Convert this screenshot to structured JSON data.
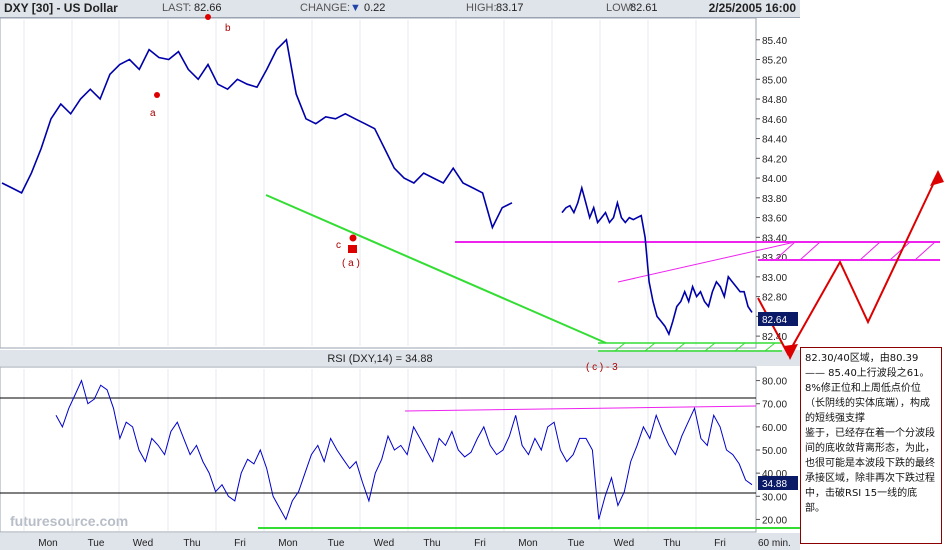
{
  "header": {
    "symbol": "DXY [30] - US Dollar",
    "last_label": "LAST:",
    "last_value": "82.66",
    "change_label": "CHANGE:",
    "change_value": "0.22",
    "high_label": "HIGH:",
    "high_value": "83.17",
    "low_label": "LOW:",
    "low_value": "82.61",
    "datetime": "2/25/2005 16:00"
  },
  "rsi_label": "RSI (DXY,14) = 34.88",
  "watermark": "futuresource.com",
  "annotations": {
    "wave_a": "a",
    "wave_b": "b",
    "wave_c": "c",
    "wave_paren_a": "( a )",
    "wave_c3": "( c ) - 3"
  },
  "note_lines": [
    "82.30/40区域，由80.39 —— 85.40上行波段之61。8%修正位和上周低点价位（长阴线的实体底端），构成的短线强支撑",
    "鉴于，已经存在着一个分波段间的底收敛背离形态，为此，也很可能是本波段下跌的最终承接区域，除非再次下跌过程中，击破RSI 15一线的底部。"
  ],
  "colors": {
    "price": "#0000aa",
    "trendline": "#33dd33",
    "magenta": "#ee22ee",
    "projection": "#dd0000",
    "header_bg": "#dfe3ea"
  },
  "chart_data": {
    "type": "line",
    "title": "DXY [30] - US Dollar",
    "x_label_unit": "60 min.",
    "x_ticks": [
      "Mon",
      "Tue",
      "Wed",
      "Thu",
      "Fri",
      "Mon",
      "Tue",
      "Wed",
      "Thu",
      "Fri",
      "Mon",
      "Tue",
      "Wed",
      "Thu",
      "Fri"
    ],
    "price_axis": {
      "ylim": [
        82.3,
        85.6
      ],
      "ticks": [
        "85.40",
        "85.20",
        "85.00",
        "84.80",
        "84.60",
        "84.40",
        "84.20",
        "84.00",
        "83.80",
        "83.60",
        "83.40",
        "83.20",
        "83.00",
        "82.80",
        "82.60",
        "82.40"
      ],
      "last_value_label": "82.64"
    },
    "rsi_axis": {
      "ylim": [
        15,
        85
      ],
      "ticks": [
        "80.00",
        "70.00",
        "60.00",
        "50.00",
        "40.00",
        "30.00",
        "20.00"
      ],
      "last_value_label": "34.88",
      "reference_lines": [
        70,
        30
      ]
    },
    "price_series": {
      "name": "DXY",
      "x": [
        0,
        3,
        5,
        8,
        10,
        12,
        14,
        15,
        17,
        19,
        21,
        23,
        25,
        27,
        30,
        32,
        34,
        36,
        38,
        40,
        42,
        44,
        46,
        48,
        50,
        53,
        55,
        57,
        59,
        61,
        63,
        64,
        66,
        68,
        70,
        72,
        74,
        76,
        77,
        78,
        80,
        82,
        84,
        86,
        88,
        90,
        92,
        94,
        96,
        98,
        100,
        102,
        104,
        106,
        108,
        110,
        111,
        113,
        115,
        117,
        119,
        121,
        123,
        125,
        127,
        129,
        131,
        133,
        135,
        137,
        139,
        141,
        143,
        145,
        147,
        149,
        151,
        153,
        155,
        157,
        159,
        161,
        163,
        165,
        167,
        169,
        171,
        173,
        175,
        177,
        179,
        181,
        183,
        185,
        187,
        189,
        191,
        193,
        195,
        197,
        199,
        201,
        203,
        205,
        207,
        209,
        211,
        213,
        215,
        217,
        219,
        221,
        223,
        225,
        227,
        229,
        231,
        233,
        235,
        237,
        239,
        241,
        243,
        245,
        247,
        249,
        251,
        253,
        255,
        257,
        259,
        261,
        263,
        265,
        267,
        269,
        271,
        273,
        275,
        277,
        279,
        281,
        283
      ],
      "values": [
        83.95,
        83.9,
        83.85,
        84.05,
        84.3,
        84.6,
        84.75,
        84.65,
        84.8,
        84.9,
        84.8,
        85.05,
        85.15,
        85.2,
        85.1,
        85.3,
        85.22,
        85.2,
        85.28,
        85.1,
        85.0,
        85.15,
        84.95,
        84.9,
        85.0,
        84.95,
        84.92,
        85.1,
        85.3,
        85.4,
        84.85,
        84.6,
        84.55,
        84.62,
        84.6,
        84.65,
        84.6,
        84.55,
        84.5,
        84.3,
        84.1,
        84.0,
        83.95,
        84.05,
        84.0,
        83.95,
        84.1,
        83.95,
        83.9,
        83.85,
        83.5,
        83.7,
        83.75,
        83.65,
        83.7,
        83.72,
        83.65,
        83.75,
        83.9,
        83.75,
        83.6,
        83.7,
        83.55,
        83.6,
        83.65,
        83.55,
        83.6,
        83.75,
        83.6,
        83.55,
        83.6,
        83.58,
        83.6,
        83.62,
        83.4,
        82.95,
        82.75,
        82.6,
        82.55,
        82.5,
        82.42,
        82.55,
        82.7,
        82.75,
        82.85,
        82.75,
        82.9,
        82.8,
        82.85,
        82.75,
        82.7,
        82.85,
        82.95,
        82.9,
        82.8,
        83.0,
        82.95,
        82.9,
        82.85,
        82.85,
        82.7,
        82.64
      ]
    },
    "rsi_series": {
      "name": "RSI",
      "values": [
        65,
        60,
        68,
        74,
        80,
        70,
        72,
        78,
        76,
        68,
        55,
        62,
        60,
        50,
        45,
        55,
        52,
        48,
        58,
        62,
        55,
        48,
        52,
        45,
        40,
        32,
        35,
        30,
        28,
        40,
        46,
        44,
        50,
        42,
        30,
        25,
        20,
        28,
        32,
        40,
        48,
        52,
        45,
        55,
        50,
        46,
        42,
        45,
        36,
        28,
        40,
        46,
        56,
        50,
        52,
        48,
        60,
        55,
        50,
        45,
        55,
        52,
        58,
        50,
        47,
        49,
        55,
        60,
        52,
        48,
        50,
        56,
        65,
        52,
        48,
        55,
        50,
        60,
        62,
        50,
        45,
        48,
        55,
        55,
        50,
        20,
        30,
        38,
        26,
        32,
        45,
        52,
        60,
        55,
        65,
        58,
        52,
        48,
        56,
        62,
        68,
        55,
        52,
        65,
        60,
        50,
        48,
        44,
        37,
        35
      ]
    }
  }
}
